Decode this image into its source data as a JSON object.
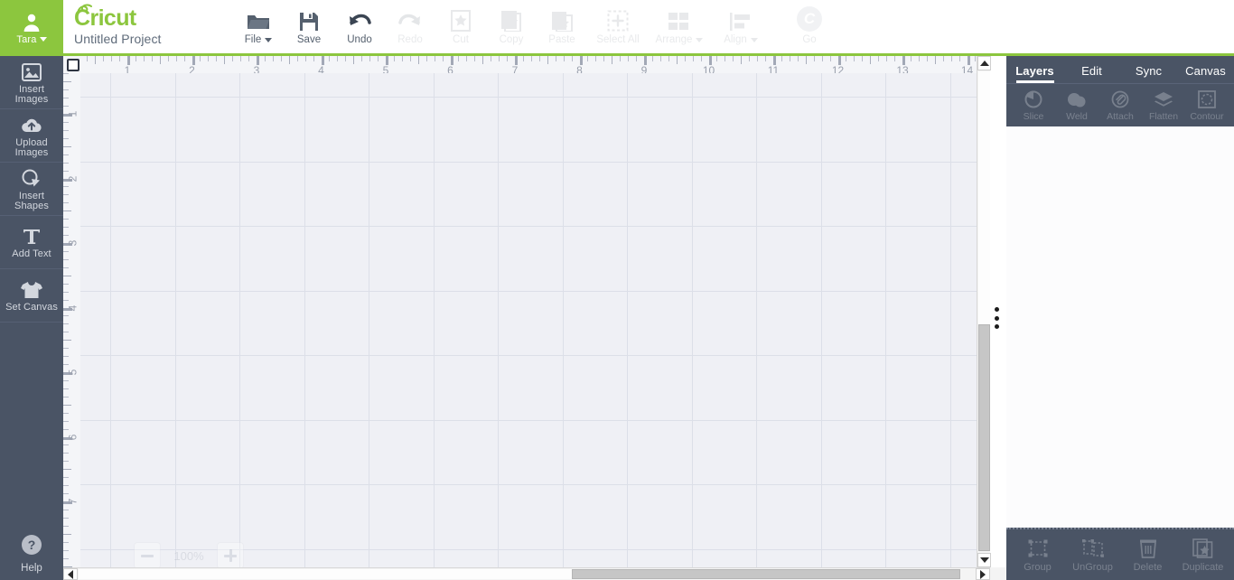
{
  "app": {
    "brand": "Cricut",
    "project_title": "Untitled Project",
    "accent_green": "#8cc63e",
    "sidebar_bg": "#4a5465"
  },
  "user": {
    "name": "Tara",
    "avatar_icon": "person-icon",
    "caret_icon": "chevron-down-icon"
  },
  "toolbar": {
    "items": [
      {
        "label": "File",
        "icon": "folder-icon",
        "disabled": false,
        "has_caret": true
      },
      {
        "label": "Save",
        "icon": "floppy-disk-icon",
        "disabled": false,
        "has_caret": false
      },
      {
        "label": "Undo",
        "icon": "arrow-undo-icon",
        "disabled": false,
        "has_caret": false
      },
      {
        "label": "Redo",
        "icon": "arrow-redo-icon",
        "disabled": true,
        "has_caret": false
      },
      {
        "label": "Cut",
        "icon": "cut-card-icon",
        "disabled": true,
        "has_caret": false
      },
      {
        "label": "Copy",
        "icon": "copy-card-icon",
        "disabled": true,
        "has_caret": false
      },
      {
        "label": "Paste",
        "icon": "paste-card-icon",
        "disabled": true,
        "has_caret": false
      },
      {
        "label": "Select All",
        "icon": "select-all-icon",
        "disabled": true,
        "has_caret": false
      },
      {
        "label": "Arrange",
        "icon": "arrange-grid-icon",
        "disabled": true,
        "has_caret": true
      },
      {
        "label": "Align",
        "icon": "align-left-icon",
        "disabled": true,
        "has_caret": true
      },
      {
        "label": "Go",
        "icon": "cricut-c-icon",
        "disabled": true,
        "has_caret": false
      }
    ]
  },
  "sidebar": {
    "items": [
      {
        "label_line1": "Insert",
        "label_line2": "Images",
        "icon": "image-icon"
      },
      {
        "label_line1": "Upload",
        "label_line2": "Images",
        "icon": "cloud-upload-icon"
      },
      {
        "label_line1": "Insert",
        "label_line2": "Shapes",
        "icon": "shapes-icon"
      },
      {
        "label_line1": "Add Text",
        "label_line2": "",
        "icon": "text-t-icon"
      },
      {
        "label_line1": "Set Canvas",
        "label_line2": "",
        "icon": "tshirt-icon"
      }
    ],
    "help": {
      "label": "Help",
      "icon": "question-circle-icon"
    }
  },
  "right_panel": {
    "tabs": [
      {
        "label": "Layers",
        "active": true
      },
      {
        "label": "Edit",
        "active": false
      },
      {
        "label": "Sync",
        "active": false
      },
      {
        "label": "Canvas",
        "active": false
      }
    ],
    "operations": [
      {
        "label": "Slice",
        "icon": "slice-icon",
        "disabled": true
      },
      {
        "label": "Weld",
        "icon": "weld-icon",
        "disabled": true
      },
      {
        "label": "Attach",
        "icon": "attach-paperclip-icon",
        "disabled": true
      },
      {
        "label": "Flatten",
        "icon": "flatten-layers-icon",
        "disabled": true
      },
      {
        "label": "Contour",
        "icon": "contour-icon",
        "disabled": true
      }
    ],
    "footer_actions": [
      {
        "label": "Group",
        "icon": "group-icon",
        "disabled": true
      },
      {
        "label": "UnGroup",
        "icon": "ungroup-icon",
        "disabled": true
      },
      {
        "label": "Delete",
        "icon": "trash-icon",
        "disabled": true
      },
      {
        "label": "Duplicate",
        "icon": "duplicate-icon",
        "disabled": true
      }
    ]
  },
  "canvas": {
    "zoom": {
      "level": "100%",
      "minus_label": "−",
      "plus_label": "+"
    },
    "ruler_h_numbers": [
      "1",
      "2",
      "3",
      "4",
      "5",
      "6",
      "7",
      "8",
      "9",
      "10",
      "11",
      "12",
      "13",
      "14"
    ],
    "ruler_v_numbers": [
      "1",
      "2",
      "3",
      "4",
      "5",
      "6",
      "7"
    ],
    "ruler_unit": "inch",
    "grid_spacing_px": 71.5,
    "background_color": "#eff0f5",
    "grid_line_color": "#dcdfe8"
  },
  "scrollbars": {
    "vertical": {
      "up_icon": "triangle-up-icon",
      "down_icon": "triangle-down-icon"
    },
    "horizontal": {
      "left_icon": "triangle-left-icon",
      "right_icon": "triangle-right-icon"
    },
    "splitter_icon": "drag-dots-icon"
  }
}
